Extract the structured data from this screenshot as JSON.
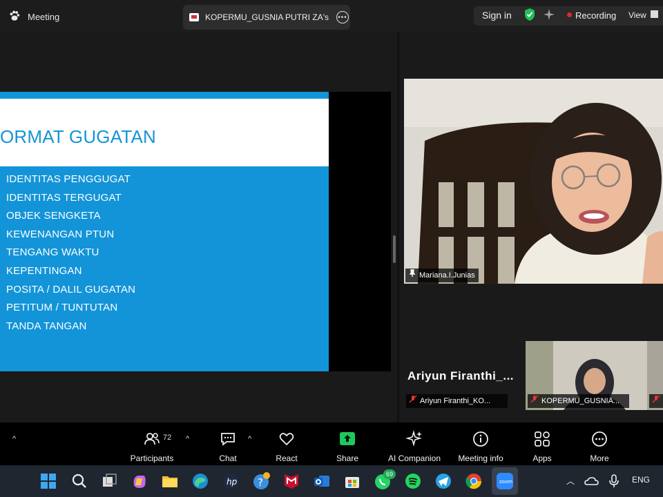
{
  "window": {
    "app_title": "Meeting",
    "share_tab_title": "KOPERMU_GUSNIA PUTRI ZA's sc",
    "sign_in": "Sign in",
    "recording": "Recording",
    "view": "View"
  },
  "slide": {
    "title": "ORMAT GUGATAN",
    "items": [
      "IDENTITAS PENGGUGAT",
      "IDENTITAS TERGUGAT",
      "OBJEK SENGKETA",
      "KEWENANGAN PTUN",
      "TENGANG WAKTU",
      "KEPENTINGAN",
      "POSITA / DALIL GUGATAN",
      "PETITUM / TUNTUTAN",
      "TANDA TANGAN"
    ]
  },
  "participants_video": {
    "main_name": "Mariana.I.Junias",
    "tile_big_name": "Ariyun  Firanthi_...",
    "tile_tag_1": "Ariyun Firanthi_KO...",
    "tile_tag_2": "KOPERMU_GUSNIA..."
  },
  "toolbar": {
    "participants_count": "72",
    "items": [
      "Participants",
      "Chat",
      "React",
      "Share",
      "AI Companion",
      "Meeting info",
      "Apps",
      "More"
    ]
  },
  "taskbar": {
    "whatsapp_badge": "69",
    "language": "ENG"
  },
  "colors": {
    "slide_blue": "#1394d8",
    "share_green": "#1ec85a",
    "recording_red": "#e02828"
  }
}
